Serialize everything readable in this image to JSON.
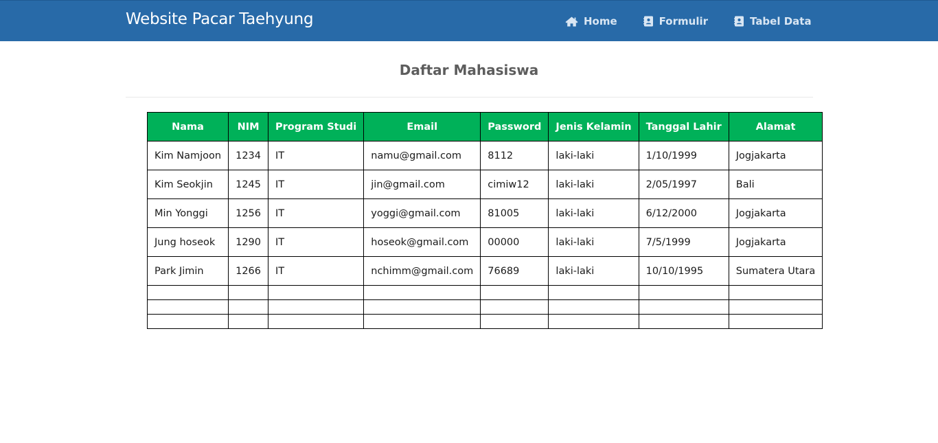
{
  "brand": "Website Pacar Taehyung",
  "nav": {
    "home": "Home",
    "formulir": "Formulir",
    "tabel_data": "Tabel Data"
  },
  "page": {
    "title": "Daftar Mahasiswa"
  },
  "table": {
    "headers": [
      "Nama",
      "NIM",
      "Program Studi",
      "Email",
      "Password",
      "Jenis Kelamin",
      "Tanggal Lahir",
      "Alamat"
    ],
    "rows": [
      [
        "Kim Namjoon",
        "1234",
        "IT",
        "namu@gmail.com",
        "8112",
        "laki-laki",
        "1/10/1999",
        "Jogjakarta"
      ],
      [
        "Kim Seokjin",
        "1245",
        "IT",
        "jin@gmail.com",
        "cimiw12",
        "laki-laki",
        "2/05/1997",
        "Bali"
      ],
      [
        "Min Yonggi",
        "1256",
        "IT",
        "yoggi@gmail.com",
        "81005",
        "laki-laki",
        "6/12/2000",
        "Jogjakarta"
      ],
      [
        "Jung hoseok",
        "1290",
        "IT",
        "hoseok@gmail.com",
        "00000",
        "laki-laki",
        "7/5/1999",
        "Jogjakarta"
      ],
      [
        "Park Jimin",
        "1266",
        "IT",
        "nchimm@gmail.com",
        "76689",
        "laki-laki",
        "10/10/1995",
        "Sumatera Utara"
      ]
    ],
    "empty_rows": 3
  },
  "colors": {
    "navbar": "#286aa8",
    "table_header": "#00b159"
  },
  "icons": {
    "home": "home-icon",
    "formulir": "address-book-icon",
    "tabel_data": "address-book-icon"
  }
}
